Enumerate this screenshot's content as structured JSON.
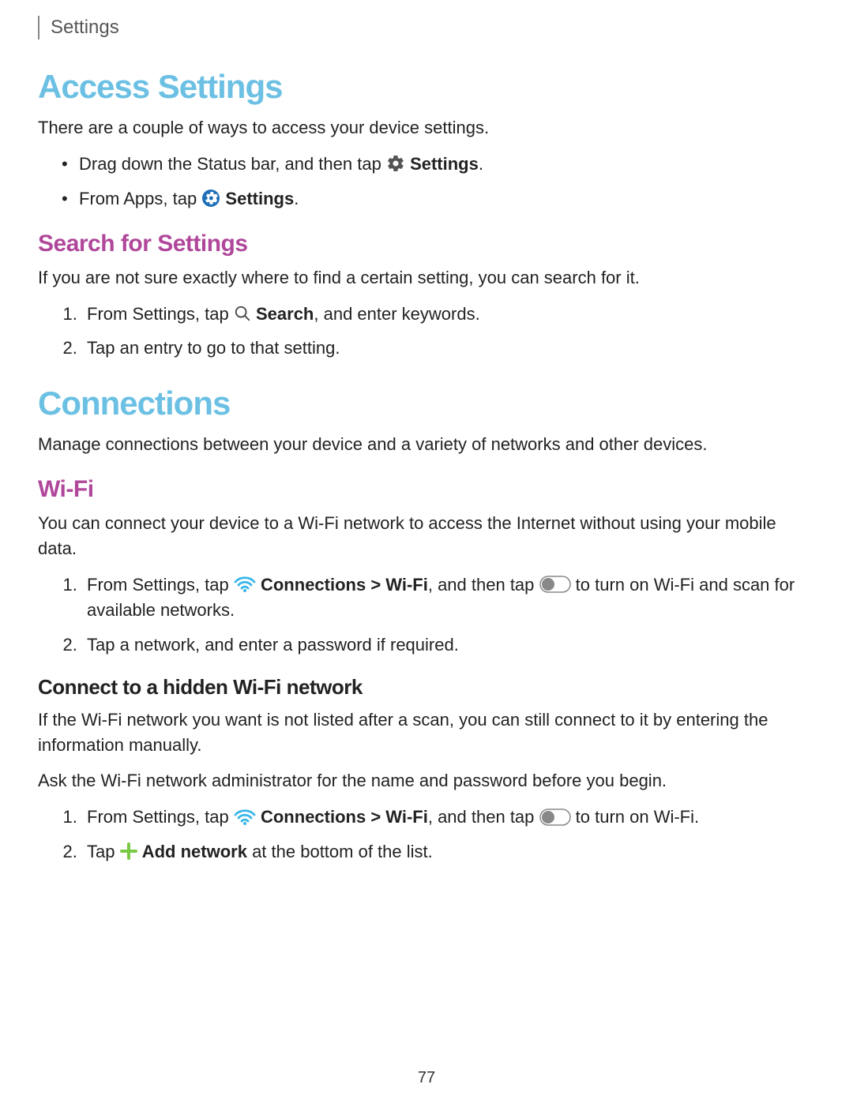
{
  "header": {
    "title": "Settings"
  },
  "page_number": "77",
  "section1": {
    "heading": "Access Settings",
    "intro": "There are a couple of ways to access your device settings.",
    "bullet1_pre": "Drag down the Status bar, and then tap ",
    "bullet1_bold": "Settings",
    "bullet1_post": ".",
    "bullet2_pre": "From Apps, tap ",
    "bullet2_bold": "Settings",
    "bullet2_post": ".",
    "sub1": {
      "heading": "Search for Settings",
      "intro": "If you are not sure exactly where to find a certain setting, you can search for it.",
      "step1_pre": "From Settings, tap ",
      "step1_bold": "Search",
      "step1_post": ", and enter keywords.",
      "step2": "Tap an entry to go to that setting."
    }
  },
  "section2": {
    "heading": "Connections",
    "intro": "Manage connections between your device and a variety of networks and other devices.",
    "sub1": {
      "heading": "Wi-Fi",
      "intro": "You can connect your device to a Wi-Fi network to access the Internet without using your mobile data.",
      "step1_pre": "From Settings, tap ",
      "step1_bold": "Connections > Wi-Fi",
      "step1_mid": ", and then tap ",
      "step1_post": " to turn on Wi-Fi and scan for available networks.",
      "step2": "Tap a network, and enter a password if required.",
      "subsub": {
        "heading": "Connect to a hidden Wi-Fi network",
        "intro": "If the Wi-Fi network you want is not listed after a scan, you can still connect to it by entering the information manually.",
        "note": "Ask the Wi-Fi network administrator for the name and password before you begin.",
        "step1_pre": "From Settings, tap ",
        "step1_bold": "Connections > Wi-Fi",
        "step1_mid": ", and then tap ",
        "step1_post": " to turn on Wi-Fi.",
        "step2_pre": "Tap ",
        "step2_bold": "Add network",
        "step2_post": " at the bottom of the list."
      }
    }
  }
}
